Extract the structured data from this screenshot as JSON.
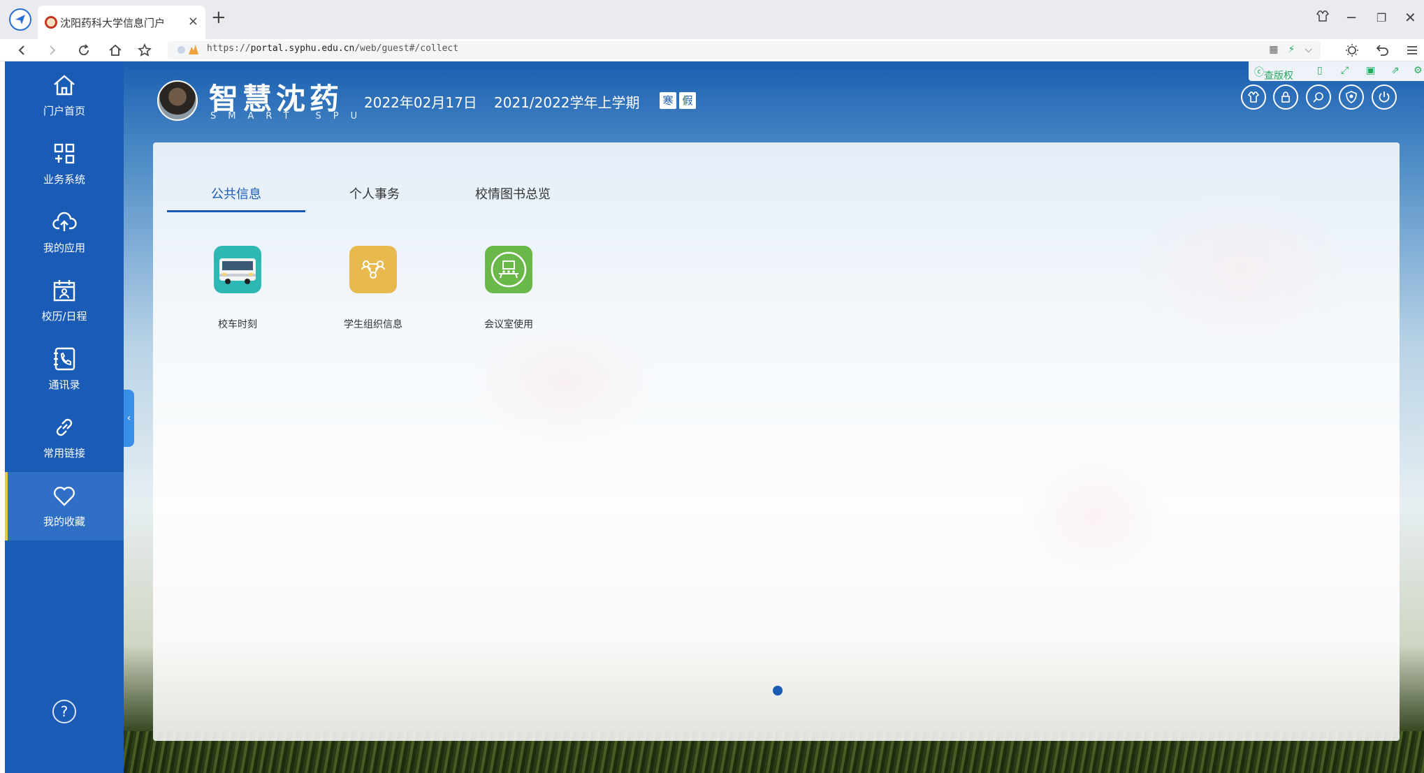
{
  "browser": {
    "tab_title": "沈阳药科大学信息门户",
    "url_prefix": "https://",
    "url_host": "portal.syphu.edu.cn",
    "url_path": "/web/guest#/collect"
  },
  "sidebar": {
    "items": [
      {
        "label": "门户首页",
        "icon": "home-icon"
      },
      {
        "label": "业务系统",
        "icon": "grid-icon"
      },
      {
        "label": "我的应用",
        "icon": "cloud-upload-icon"
      },
      {
        "label": "校历/日程",
        "icon": "calendar-icon"
      },
      {
        "label": "通讯录",
        "icon": "phone-book-icon"
      },
      {
        "label": "常用链接",
        "icon": "link-icon"
      },
      {
        "label": "我的收藏",
        "icon": "heart-icon"
      }
    ],
    "active": "我的收藏",
    "help": "?"
  },
  "header": {
    "brand": "智慧沈药",
    "brand_sub": "SMART SPU",
    "date": "2022年02月17日",
    "term": "2021/2022学年上学期",
    "badges": [
      "寒",
      "假"
    ],
    "tools": [
      "查版权"
    ],
    "actions": [
      "shirt-icon",
      "lock-icon",
      "search-icon",
      "shield-icon",
      "power-icon"
    ]
  },
  "panel": {
    "tabs": [
      "公共信息",
      "个人事务",
      "校情图书总览"
    ],
    "active_tab": "公共信息",
    "apps": [
      {
        "label": "校车时刻",
        "icon": "bus-icon",
        "color": "#2fb7b3"
      },
      {
        "label": "学生组织信息",
        "icon": "organization-icon",
        "color": "#e8b94e"
      },
      {
        "label": "会议室使用",
        "icon": "meeting-room-icon",
        "color": "#6bb84a"
      }
    ],
    "page_count": 1
  },
  "colors": {
    "sidebar": "#1a5bb6",
    "accent": "#1a5bb6",
    "active_marker": "#e6c74b"
  }
}
